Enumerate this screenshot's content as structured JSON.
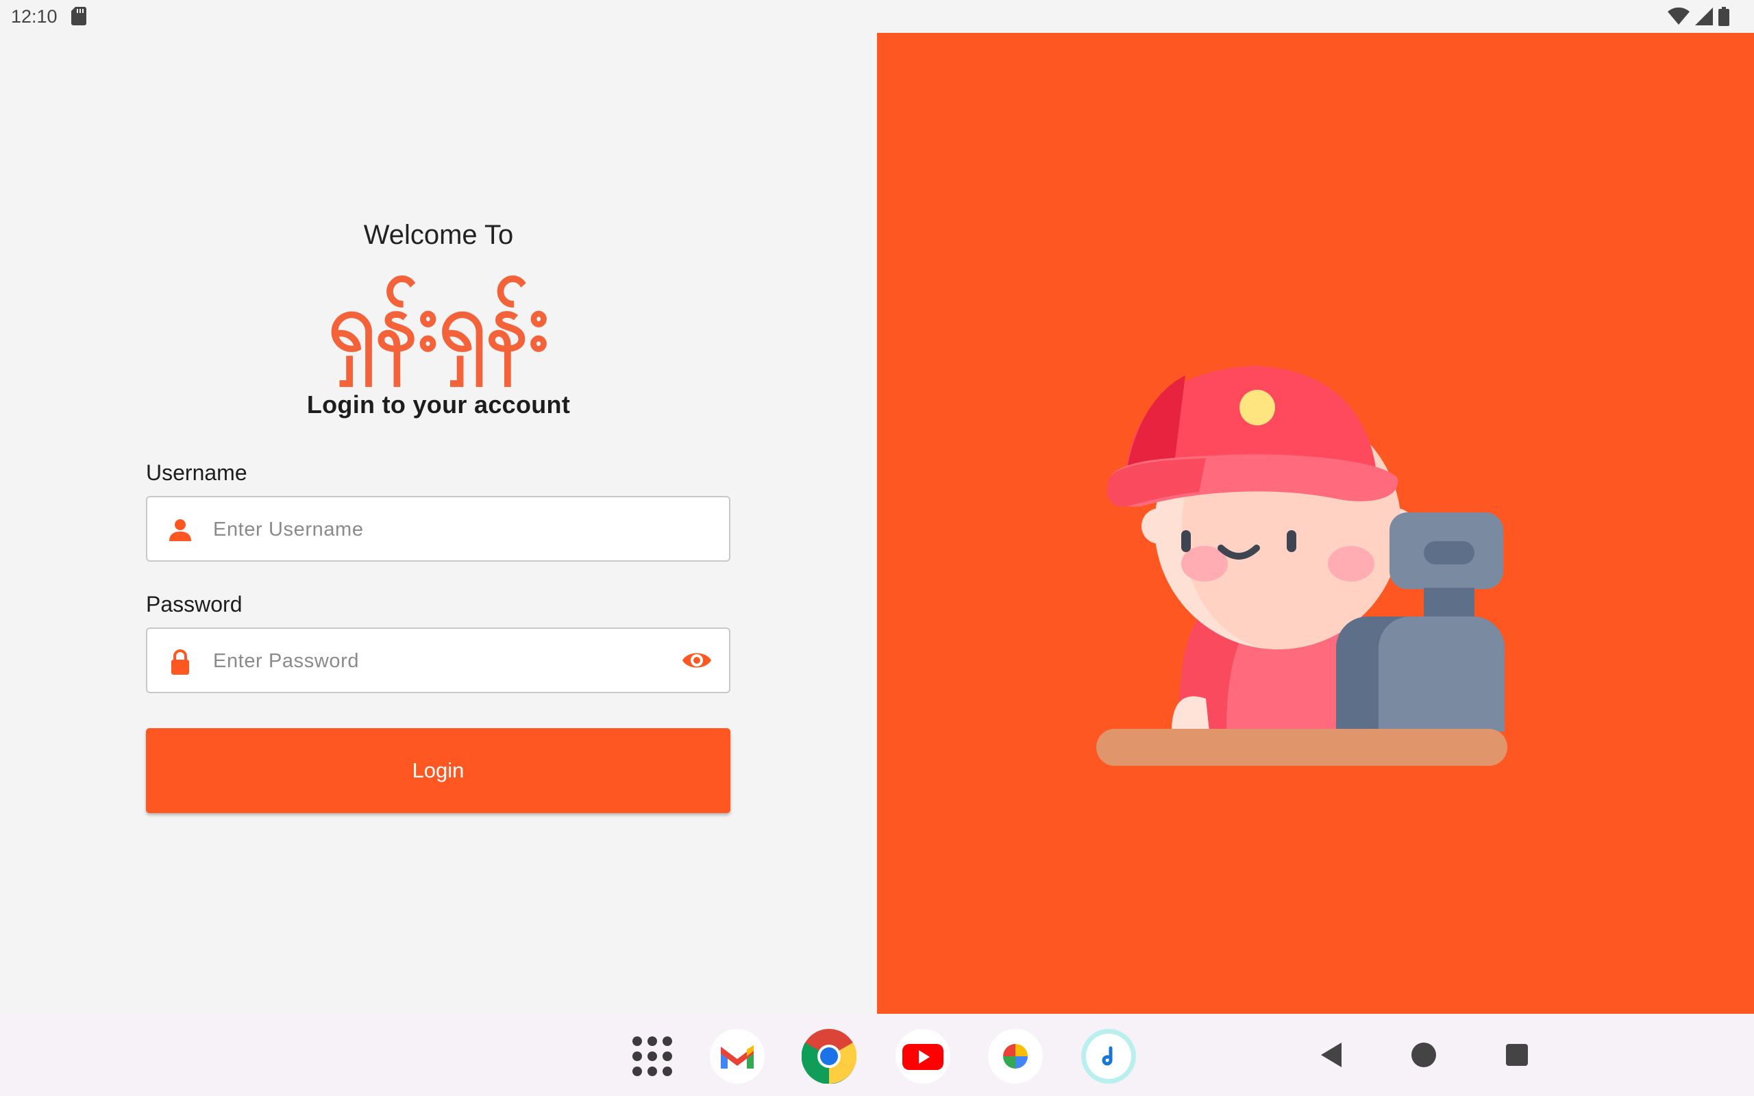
{
  "status_bar": {
    "time": "12:10",
    "icons": [
      "sd-card-icon",
      "wifi-icon",
      "signal-icon",
      "battery-icon"
    ]
  },
  "login": {
    "welcome_text": "Welcome To",
    "brand_name": "ရှန်းရှန်း",
    "heading": "Login to your account",
    "username_label": "Username",
    "username_placeholder": "Enter Username",
    "username_value": "",
    "password_label": "Password",
    "password_placeholder": "Enter Password",
    "password_value": "",
    "login_button": "Login"
  },
  "colors": {
    "accent": "#ff5722",
    "brand_text": "#f4623a",
    "background": "#f4f4f4"
  },
  "dock": {
    "apps": [
      "app-drawer-icon",
      "gmail-icon",
      "chrome-icon",
      "youtube-icon",
      "photos-icon",
      "app-icon"
    ]
  },
  "navigation": [
    "back-icon",
    "home-icon",
    "recents-icon"
  ]
}
